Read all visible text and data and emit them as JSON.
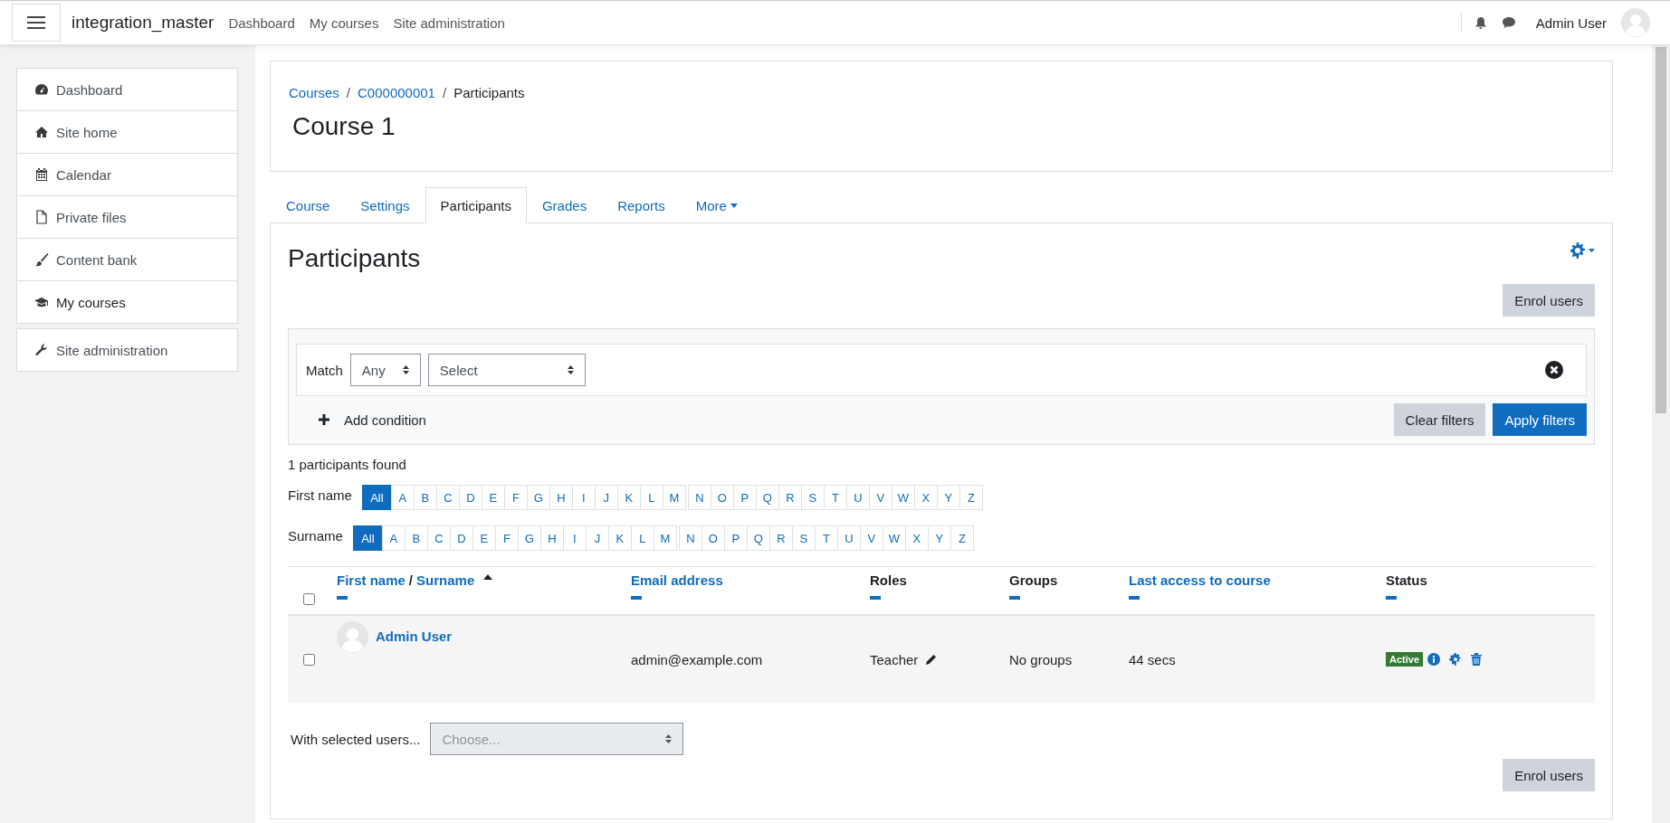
{
  "navbar": {
    "brand": "integration_master",
    "links": [
      "Dashboard",
      "My courses",
      "Site administration"
    ],
    "user_name": "Admin User"
  },
  "sidebar": {
    "groups": [
      [
        {
          "label": "Dashboard",
          "selected": false
        },
        {
          "label": "Site home",
          "selected": false
        },
        {
          "label": "Calendar",
          "selected": false
        },
        {
          "label": "Private files",
          "selected": false
        },
        {
          "label": "Content bank",
          "selected": false
        },
        {
          "label": "My courses",
          "selected": true
        }
      ],
      [
        {
          "label": "Site administration",
          "selected": false
        }
      ]
    ]
  },
  "header": {
    "separator": "/",
    "breadcrumb": [
      {
        "label": "Courses",
        "current": false
      },
      {
        "label": "C000000001",
        "current": false
      },
      {
        "label": "Participants",
        "current": true
      }
    ],
    "title": "Course 1"
  },
  "tabs": [
    {
      "label": "Course",
      "selected": false,
      "has_menu": false
    },
    {
      "label": "Settings",
      "selected": false,
      "has_menu": false
    },
    {
      "label": "Participants",
      "selected": true,
      "has_menu": false
    },
    {
      "label": "Grades",
      "selected": false,
      "has_menu": false
    },
    {
      "label": "Reports",
      "selected": false,
      "has_menu": false
    },
    {
      "label": "More",
      "selected": false,
      "has_menu": true
    }
  ],
  "heading": "Participants",
  "enrol_button_top": "Enrol users",
  "filter": {
    "match_label": "Match",
    "match_value": "Any",
    "type_value": "Select",
    "add_condition": "Add condition",
    "clear_button": "Clear filters",
    "apply_button": "Apply filters"
  },
  "count": "1 participants found",
  "initials_bars": [
    {
      "label": "First name",
      "groups": [
        [
          {
            "letter": "All",
            "selected": true
          },
          {
            "letter": "A",
            "selected": false
          },
          {
            "letter": "B",
            "selected": false
          },
          {
            "letter": "C",
            "selected": false
          },
          {
            "letter": "D",
            "selected": false
          },
          {
            "letter": "E",
            "selected": false
          },
          {
            "letter": "F",
            "selected": false
          },
          {
            "letter": "G",
            "selected": false
          },
          {
            "letter": "H",
            "selected": false
          },
          {
            "letter": "I",
            "selected": false
          },
          {
            "letter": "J",
            "selected": false
          },
          {
            "letter": "K",
            "selected": false
          },
          {
            "letter": "L",
            "selected": false
          },
          {
            "letter": "M",
            "selected": false
          }
        ],
        [
          {
            "letter": "N",
            "selected": false
          },
          {
            "letter": "O",
            "selected": false
          },
          {
            "letter": "P",
            "selected": false
          },
          {
            "letter": "Q",
            "selected": false
          },
          {
            "letter": "R",
            "selected": false
          },
          {
            "letter": "S",
            "selected": false
          },
          {
            "letter": "T",
            "selected": false
          },
          {
            "letter": "U",
            "selected": false
          },
          {
            "letter": "V",
            "selected": false
          },
          {
            "letter": "W",
            "selected": false
          },
          {
            "letter": "X",
            "selected": false
          },
          {
            "letter": "Y",
            "selected": false
          },
          {
            "letter": "Z",
            "selected": false
          }
        ]
      ]
    },
    {
      "label": "Surname",
      "groups": [
        [
          {
            "letter": "All",
            "selected": true
          },
          {
            "letter": "A",
            "selected": false
          },
          {
            "letter": "B",
            "selected": false
          },
          {
            "letter": "C",
            "selected": false
          },
          {
            "letter": "D",
            "selected": false
          },
          {
            "letter": "E",
            "selected": false
          },
          {
            "letter": "F",
            "selected": false
          },
          {
            "letter": "G",
            "selected": false
          },
          {
            "letter": "H",
            "selected": false
          },
          {
            "letter": "I",
            "selected": false
          },
          {
            "letter": "J",
            "selected": false
          },
          {
            "letter": "K",
            "selected": false
          },
          {
            "letter": "L",
            "selected": false
          },
          {
            "letter": "M",
            "selected": false
          }
        ],
        [
          {
            "letter": "N",
            "selected": false
          },
          {
            "letter": "O",
            "selected": false
          },
          {
            "letter": "P",
            "selected": false
          },
          {
            "letter": "Q",
            "selected": false
          },
          {
            "letter": "R",
            "selected": false
          },
          {
            "letter": "S",
            "selected": false
          },
          {
            "letter": "T",
            "selected": false
          },
          {
            "letter": "U",
            "selected": false
          },
          {
            "letter": "V",
            "selected": false
          },
          {
            "letter": "W",
            "selected": false
          },
          {
            "letter": "X",
            "selected": false
          },
          {
            "letter": "Y",
            "selected": false
          },
          {
            "letter": "Z",
            "selected": false
          }
        ]
      ]
    }
  ],
  "table": {
    "select_all_checked": false,
    "columns": [
      {
        "labels": [
          "First name",
          "Surname"
        ],
        "separator": "/",
        "link": true,
        "sorted_ascending": true
      },
      {
        "labels": [
          "Email address"
        ],
        "link": true
      },
      {
        "labels": [
          "Roles"
        ],
        "link": false
      },
      {
        "labels": [
          "Groups"
        ],
        "link": false
      },
      {
        "labels": [
          "Last access to course"
        ],
        "link": true
      },
      {
        "labels": [
          "Status"
        ],
        "link": false
      }
    ],
    "rows": [
      {
        "checked": false,
        "name": "Admin User",
        "email": "admin@example.com",
        "role": "Teacher",
        "groups": "No groups",
        "last_access": "44 secs",
        "status": "Active"
      }
    ]
  },
  "bulk": {
    "label": "With selected users...",
    "value": "Choose...",
    "disabled": true
  },
  "enrol_button_bottom": "Enrol users"
}
